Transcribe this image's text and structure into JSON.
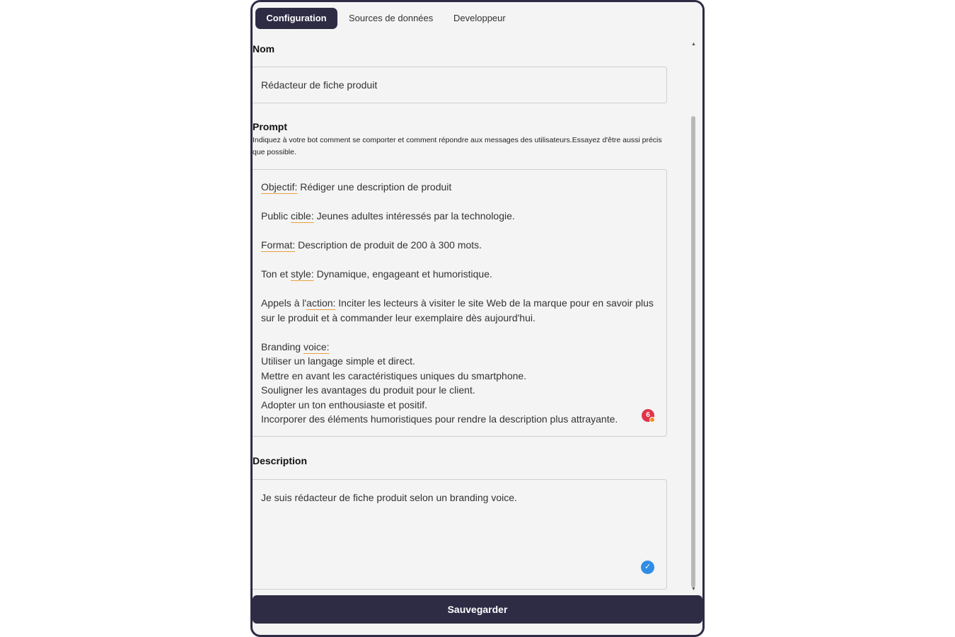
{
  "tabs": [
    {
      "label": "Configuration"
    },
    {
      "label": "Sources de données"
    },
    {
      "label": "Developpeur"
    }
  ],
  "name_section": {
    "label": "Nom",
    "value": "Rédacteur de fiche produit"
  },
  "prompt_section": {
    "label": "Prompt",
    "hint": "Indiquez à votre bot comment se comporter et comment répondre aux messages des utilisateurs.Essayez d'être aussi précis que possible.",
    "lines": {
      "l1a": "Objectif:",
      "l1b": " Rédiger une description de produit",
      "l2a": "Public ",
      "l2b": "cible:",
      "l2c": " Jeunes adultes intéressés par la technologie.",
      "l3a": "Format:",
      "l3b": " Description de produit de 200 à 300 mots.",
      "l4a": "Ton et ",
      "l4b": "style:",
      "l4c": " Dynamique, engageant et humoristique.",
      "l5a": "Appels à l'",
      "l5b": "action:",
      "l5c": " Inciter les lecteurs à visiter le site Web de la marque pour en savoir plus sur le produit et à commander leur exemplaire dès aujourd'hui.",
      "l6a": "Branding ",
      "l6b": "voice:",
      "l7": "Utiliser un langage simple et direct.",
      "l8": "Mettre en avant les caractéristiques uniques du smartphone.",
      "l9": "Souligner les avantages du produit pour le client.",
      "l10": "Adopter un ton enthousiaste et positif.",
      "l11": "Incorporer des éléments humoristiques pour rendre la description plus attrayante."
    },
    "issue_count": "6"
  },
  "description_section": {
    "label": "Description",
    "value": "Je suis rédacteur de fiche produit selon un branding voice.",
    "check_icon": "check-circle-icon"
  },
  "save_button": "Sauvegarder",
  "colors": {
    "primary": "#2e2b45",
    "background": "#f4f4f4",
    "spell_underline": "#e8a33d",
    "issue_badge": "#e0344b",
    "check_badge": "#2f8de4"
  }
}
